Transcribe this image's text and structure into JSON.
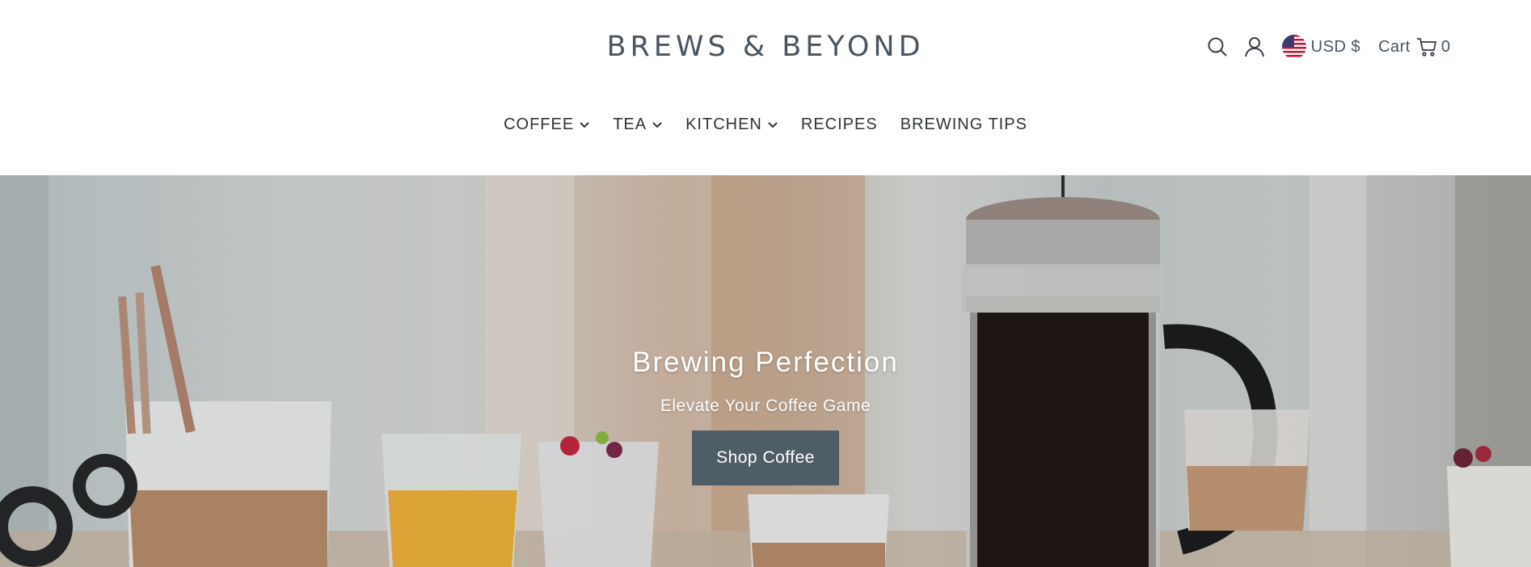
{
  "brand": {
    "logo_text": "BREWS & BEYOND"
  },
  "utilities": {
    "search_icon": "search-icon",
    "account_icon": "user-icon",
    "currency_label": "USD $",
    "currency_flag": "us-flag-icon",
    "cart_label": "Cart",
    "cart_icon": "cart-icon",
    "cart_count": "0"
  },
  "nav": {
    "items": [
      {
        "label": "COFFEE",
        "has_dropdown": true
      },
      {
        "label": "TEA",
        "has_dropdown": true
      },
      {
        "label": "KITCHEN",
        "has_dropdown": true
      },
      {
        "label": "RECIPES",
        "has_dropdown": false
      },
      {
        "label": "BREWING TIPS",
        "has_dropdown": false
      }
    ]
  },
  "hero": {
    "title": "Brewing Perfection",
    "subtitle": "Elevate Your Coffee Game",
    "cta_label": "Shop Coffee"
  },
  "colors": {
    "logo": "#4a5560",
    "nav_text": "#2f3437",
    "cta_bg": "#4f5d67",
    "hero_text": "#ffffff"
  }
}
